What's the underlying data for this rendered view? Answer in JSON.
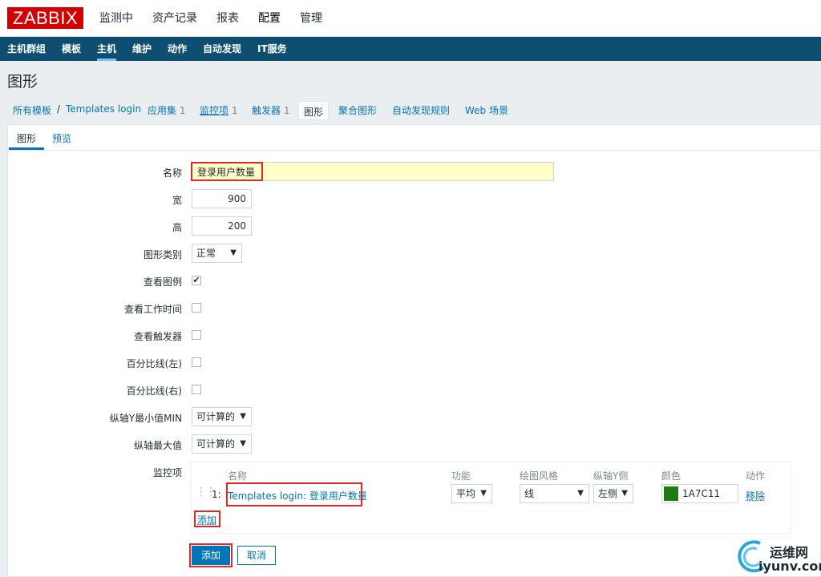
{
  "logo": "ZABBIX",
  "top_menu": [
    "监测中",
    "资产记录",
    "报表",
    "配置",
    "管理"
  ],
  "sub_menu": [
    "主机群组",
    "模板",
    "主机",
    "维护",
    "动作",
    "自动发现",
    "IT服务"
  ],
  "page_title": "图形",
  "breadcrumb": {
    "all_templates": "所有模板",
    "separator": "/",
    "template": "Templates login",
    "apps": "应用集",
    "apps_count": "1",
    "items": "监控项",
    "items_count": "1",
    "triggers": "触发器",
    "triggers_count": "1",
    "graphs": "图形",
    "screens": "聚合图形",
    "discovery": "自动发现规则",
    "web": "Web 场景"
  },
  "tabs": [
    "图形",
    "预览"
  ],
  "form": {
    "name_label": "名称",
    "name_value": "登录用户数量",
    "width_label": "宽",
    "width_value": "900",
    "height_label": "高",
    "height_value": "200",
    "type_label": "图形类别",
    "type_value": "正常",
    "legend_label": "查看图例",
    "worktime_label": "查看工作时间",
    "triggers_label": "查看触发器",
    "percent_left_label": "百分比线(左)",
    "percent_right_label": "百分比线(右)",
    "ymin_label": "纵轴Y最小值MIN",
    "ymin_value": "可计算的",
    "ymax_label": "纵轴最大值",
    "ymax_value": "可计算的",
    "items_label": "监控项"
  },
  "items_table": {
    "headers": [
      "名称",
      "功能",
      "绘图风格",
      "纵轴Y侧",
      "颜色",
      "动作"
    ],
    "rows": [
      {
        "index": "1:",
        "name": "Templates login: 登录用户数量",
        "function": "平均",
        "style": "线",
        "yaxis": "左侧",
        "color_hex": "#1A7C11",
        "color": "1A7C11",
        "action": "移除"
      }
    ],
    "add_link": "添加"
  },
  "buttons": {
    "add": "添加",
    "cancel": "取消"
  },
  "watermark": {
    "line1": "运维网",
    "line2": "iyunv.com"
  },
  "colors": {
    "brand": "#d40000",
    "nav": "#0e4f71",
    "accent": "#0275b8",
    "highlight": "#e02828"
  }
}
